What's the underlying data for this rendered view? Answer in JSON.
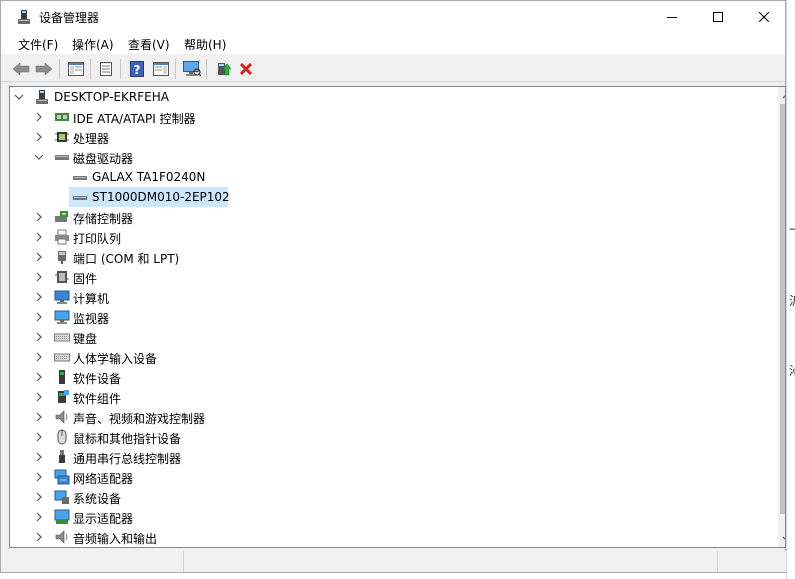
{
  "window": {
    "title": "设备管理器"
  },
  "menu": {
    "items": [
      "文件(F)",
      "操作(A)",
      "查看(V)",
      "帮助(H)"
    ]
  },
  "tree": {
    "root": "DESKTOP-EKRFEHA",
    "categories": [
      {
        "label": "IDE ATA/ATAPI 控制器",
        "icon": "ide-controller-icon",
        "expanded": false
      },
      {
        "label": "处理器",
        "icon": "processor-icon",
        "expanded": false
      },
      {
        "label": "磁盘驱动器",
        "icon": "disk-drive-icon",
        "expanded": true
      },
      {
        "label": "存储控制器",
        "icon": "storage-controller-icon",
        "expanded": false
      },
      {
        "label": "打印队列",
        "icon": "printer-icon",
        "expanded": false
      },
      {
        "label": "端口 (COM 和 LPT)",
        "icon": "port-icon",
        "expanded": false
      },
      {
        "label": "固件",
        "icon": "firmware-icon",
        "expanded": false
      },
      {
        "label": "计算机",
        "icon": "computer-icon",
        "expanded": false
      },
      {
        "label": "监视器",
        "icon": "monitor-icon",
        "expanded": false
      },
      {
        "label": "键盘",
        "icon": "keyboard-icon",
        "expanded": false
      },
      {
        "label": "人体学输入设备",
        "icon": "hid-icon",
        "expanded": false
      },
      {
        "label": "软件设备",
        "icon": "software-device-icon",
        "expanded": false
      },
      {
        "label": "软件组件",
        "icon": "software-component-icon",
        "expanded": false
      },
      {
        "label": "声音、视频和游戏控制器",
        "icon": "sound-icon",
        "expanded": false
      },
      {
        "label": "鼠标和其他指针设备",
        "icon": "mouse-icon",
        "expanded": false
      },
      {
        "label": "通用串行总线控制器",
        "icon": "usb-icon",
        "expanded": false
      },
      {
        "label": "网络适配器",
        "icon": "network-adapter-icon",
        "expanded": false
      },
      {
        "label": "系统设备",
        "icon": "system-device-icon",
        "expanded": false
      },
      {
        "label": "显示适配器",
        "icon": "display-adapter-icon",
        "expanded": false
      },
      {
        "label": "音频输入和输出",
        "icon": "audio-io-icon",
        "expanded": false
      }
    ],
    "disk_children": [
      {
        "label": "GALAX TA1F0240N",
        "selected": false
      },
      {
        "label": "ST1000DM010-2EP102",
        "selected": true
      }
    ]
  },
  "edge_fragments": [
    "→",
    "沂",
    "沁"
  ],
  "colors": {
    "selection": "#cce8ff",
    "delete_red": "#d42020",
    "scrollbar_thumb": "#c2c2c2"
  }
}
